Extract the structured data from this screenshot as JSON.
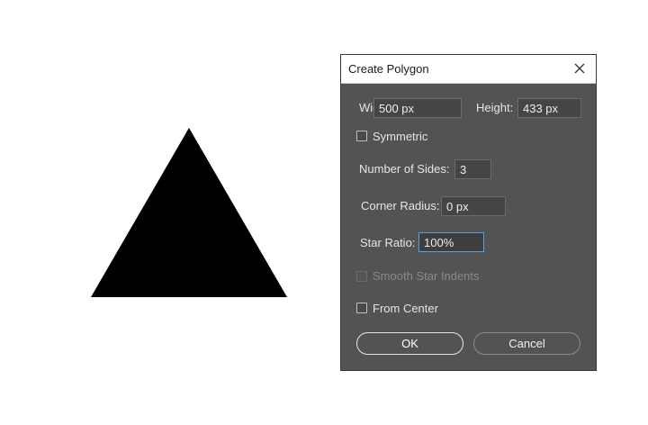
{
  "dialog": {
    "title": "Create Polygon",
    "width_label": "Width:",
    "width_value": "500 px",
    "height_label": "Height:",
    "height_value": "433 px",
    "symmetric_label": "Symmetric",
    "symmetric_checked": false,
    "sides_label": "Number of Sides:",
    "sides_value": "3",
    "corner_label": "Corner Radius:",
    "corner_value": "0 px",
    "star_label": "Star Ratio:",
    "star_value": "100%",
    "smooth_label": "Smooth Star Indents",
    "smooth_enabled": false,
    "from_center_label": "From Center",
    "from_center_checked": false,
    "ok_label": "OK",
    "cancel_label": "Cancel"
  },
  "colors": {
    "dialog_bg": "#535353",
    "shape_fill": "#000000",
    "focus_border": "#5aa0e0"
  },
  "icons": {
    "close": "close-icon"
  }
}
